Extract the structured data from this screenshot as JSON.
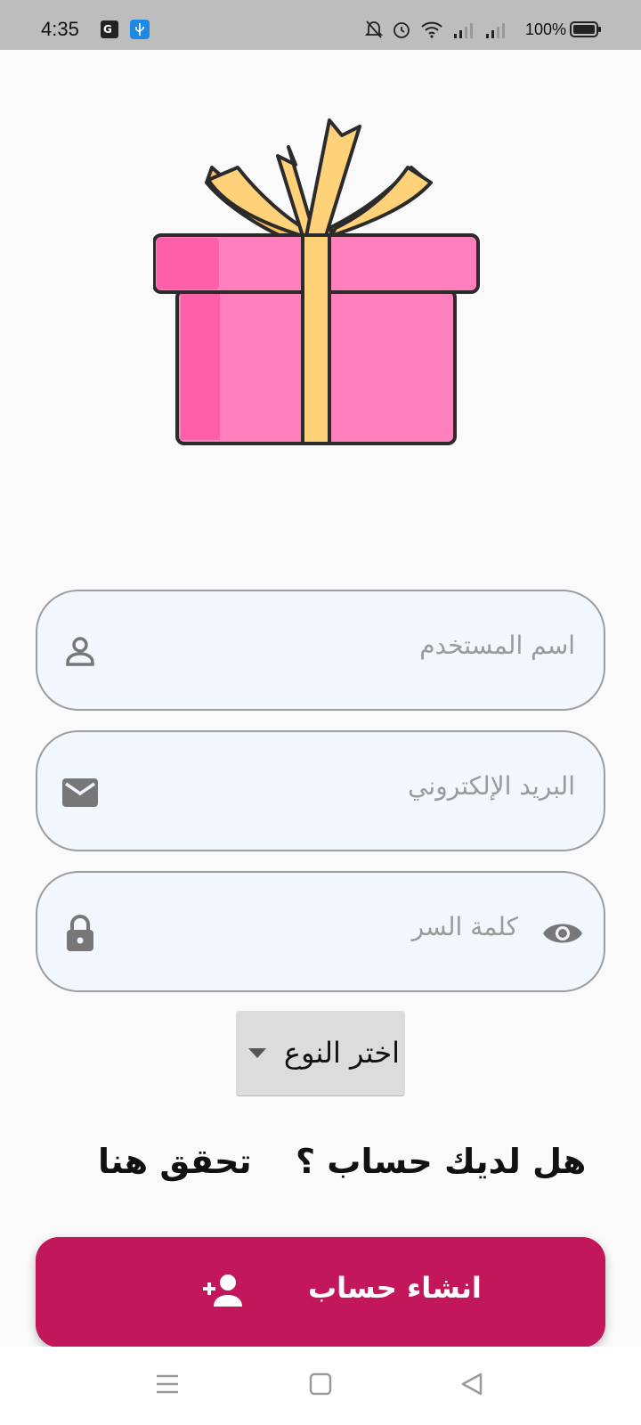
{
  "status_bar": {
    "time": "4:35",
    "battery": "100%",
    "icons": [
      "translate-icon",
      "usb-icon",
      "bell-off-icon",
      "alarm-icon",
      "wifi-icon",
      "signal-icon",
      "signal-icon",
      "battery-icon"
    ]
  },
  "form": {
    "username_placeholder": "اسم المستخدم",
    "email_placeholder": "البريد الإلكتروني",
    "password_placeholder": "كلمة السر",
    "type_dropdown": "اختر النوع"
  },
  "account": {
    "question": "هل لديك حساب ؟",
    "link": "تحقق هنا"
  },
  "create_button": {
    "label": "انشاء حساب",
    "icon": "person-add-icon"
  },
  "colors": {
    "primary": "#c2185b",
    "field_bg": "#f1f7fd",
    "gift_pink": "#ff80bc",
    "gift_ribbon": "#ffd27a"
  }
}
